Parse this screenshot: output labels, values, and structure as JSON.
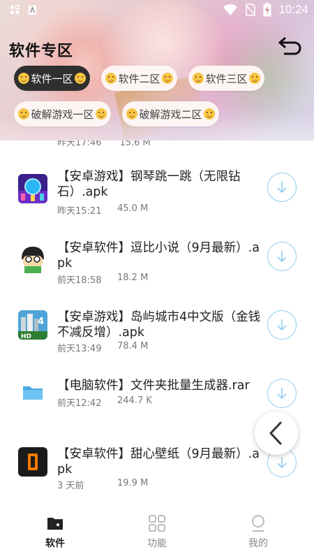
{
  "status_bar": {
    "time": "10:24"
  },
  "page_title": "软件专区",
  "categories": [
    {
      "label": "软件一区",
      "active": true
    },
    {
      "label": "软件二区",
      "active": false
    },
    {
      "label": "软件三区",
      "active": false
    },
    {
      "label": "破解游戏一区",
      "active": false
    },
    {
      "label": "破解游戏二区",
      "active": false
    }
  ],
  "partial_item": {
    "time": "昨天17:46",
    "size": "15.6 M"
  },
  "files": [
    {
      "title": "【安卓游戏】钢琴跳一跳（无限钻石）.apk",
      "time": "昨天15:21",
      "size": "45.0 M",
      "icon": "piano-game-icon"
    },
    {
      "title": "【安卓软件】逗比小说（9月最新）.apk",
      "time": "前天18:58",
      "size": "18.2 M",
      "icon": "cartoon-face-icon"
    },
    {
      "title": "【安卓游戏】岛屿城市4中文版（金钱不减反增）.apk",
      "time": "前天13:49",
      "size": "78.4 M",
      "icon": "city-island-icon"
    },
    {
      "title": "【电脑软件】文件夹批量生成器.rar",
      "time": "前天12:42",
      "size": "244.7 K",
      "icon": "folder-icon"
    },
    {
      "title": "【安卓软件】甜心壁纸（9月最新）.apk",
      "time": "3 天前",
      "size": "19.9 M",
      "icon": "wallpaper-app-icon"
    }
  ],
  "bottom_nav": [
    {
      "label": "软件",
      "active": true,
      "icon": "folder-icon"
    },
    {
      "label": "功能",
      "active": false,
      "icon": "grid-icon"
    },
    {
      "label": "我的",
      "active": false,
      "icon": "user-icon"
    }
  ],
  "colors": {
    "accent_blue": "#8fcdee",
    "folder_blue": "#5ab6ea",
    "active_chip": "#2f2f2f"
  }
}
